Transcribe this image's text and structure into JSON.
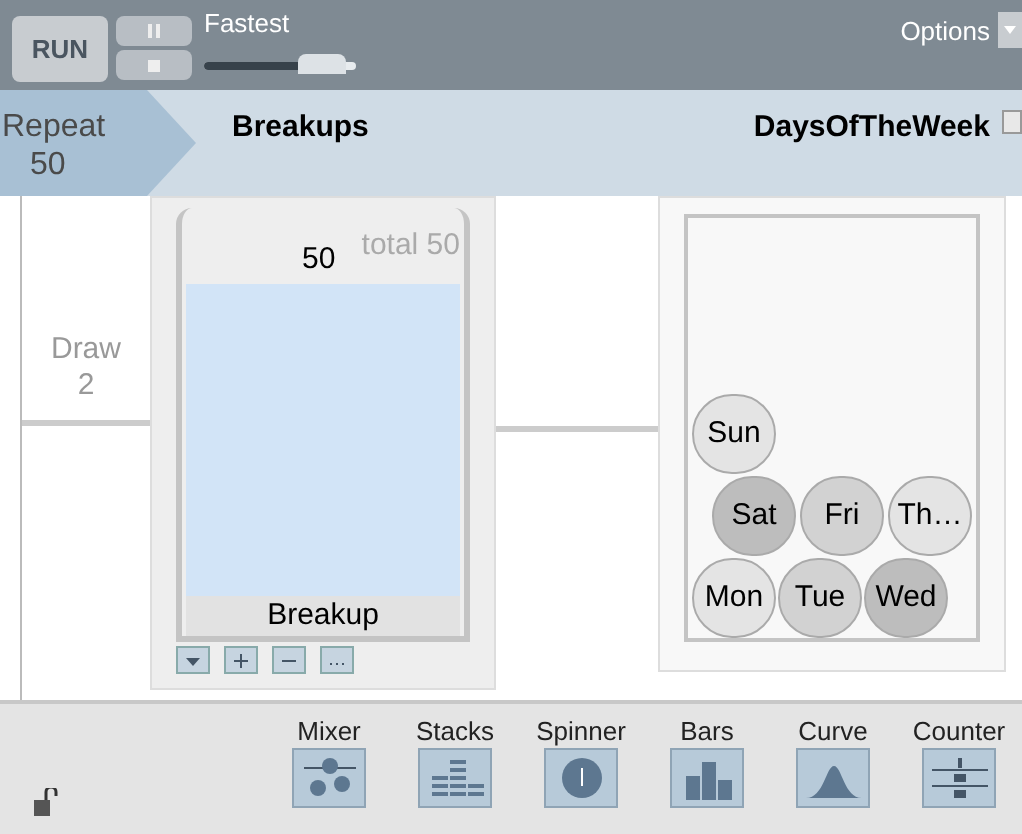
{
  "toolbar": {
    "run_label": "RUN",
    "speed_label": "Fastest",
    "speed": {
      "level": 0.8
    },
    "options_label": "Options"
  },
  "header": {
    "repeat_label": "Repeat",
    "repeat_count": "50",
    "device_names": [
      "Breakups",
      "DaysOfTheWeek"
    ]
  },
  "draw": {
    "label": "Draw",
    "count": "2"
  },
  "stacks": {
    "count": "50",
    "total": "total 50",
    "label": "Breakup"
  },
  "mixer": {
    "balls": [
      {
        "text": "Sun",
        "color": "#e4e4e4"
      },
      {
        "text": "Sat",
        "color": "#bdbdbd"
      },
      {
        "text": "Fri",
        "color": "#d2d2d2"
      },
      {
        "text": "Th…",
        "color": "#e4e4e4"
      },
      {
        "text": "Mon",
        "color": "#e4e4e4"
      },
      {
        "text": "Tue",
        "color": "#d2d2d2"
      },
      {
        "text": "Wed",
        "color": "#bdbdbd"
      }
    ]
  },
  "palette": [
    {
      "kind": "mixer",
      "label": "Mixer"
    },
    {
      "kind": "stacks",
      "label": "Stacks"
    },
    {
      "kind": "spinner",
      "label": "Spinner"
    },
    {
      "kind": "bars",
      "label": "Bars"
    },
    {
      "kind": "curve",
      "label": "Curve"
    },
    {
      "kind": "counter",
      "label": "Counter"
    }
  ]
}
